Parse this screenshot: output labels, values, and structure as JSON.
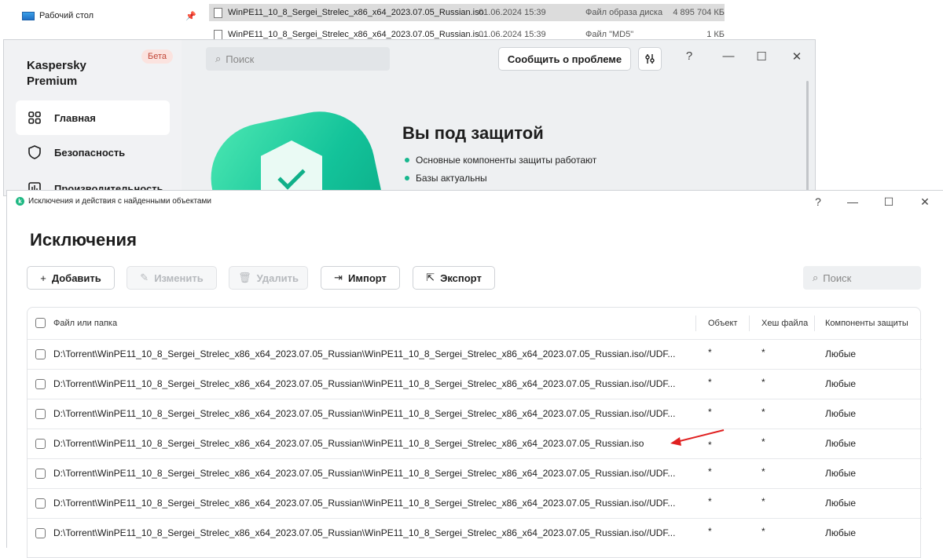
{
  "explorer": {
    "nav_desktop": "Рабочий стол",
    "files": [
      {
        "name": "WinPE11_10_8_Sergei_Strelec_x86_x64_2023.07.05_Russian.iso",
        "date": "01.06.2024 15:39",
        "type": "Файл образа диска",
        "size": "4 895 704 КБ"
      },
      {
        "name": "WinPE11_10_8_Sergei_Strelec_x86_x64_2023.07.05_Russian.is...",
        "date": "01.06.2024 15:39",
        "type": "Файл \"MD5\"",
        "size": "1 КБ"
      }
    ]
  },
  "kaspersky": {
    "brand": "Kaspersky Premium",
    "beta_badge": "Бета",
    "search_placeholder": "Поиск",
    "report_button": "Сообщить о проблеме",
    "window_controls": {
      "help": "?",
      "minimize": "—",
      "maximize": "☐",
      "close": "✕"
    },
    "sidebar": [
      {
        "label": "Главная",
        "icon": "grid-icon",
        "active": true
      },
      {
        "label": "Безопасность",
        "icon": "shield-icon",
        "active": false
      },
      {
        "label": "Производительность",
        "icon": "performance-icon",
        "active": false
      }
    ],
    "status": {
      "title": "Вы под защитой",
      "items": [
        "Основные компоненты защиты работают",
        "Базы актуальны"
      ]
    },
    "colors": {
      "accent": "#13c39a",
      "beta_bg": "#fbe3df",
      "beta_text": "#c2493a"
    }
  },
  "exceptions": {
    "window_title": "Исключения и действия с найденными объектами",
    "heading": "Исключения",
    "toolbar": {
      "add": "Добавить",
      "edit": "Изменить",
      "delete": "Удалить",
      "import": "Импорт",
      "export": "Экспорт",
      "search_placeholder": "Поиск"
    },
    "columns": [
      "Файл или папка",
      "Объект",
      "Хеш файла",
      "Компоненты защиты"
    ],
    "rows": [
      {
        "path": "D:\\Torrent\\WinPE11_10_8_Sergei_Strelec_x86_x64_2023.07.05_Russian\\WinPE11_10_8_Sergei_Strelec_x86_x64_2023.07.05_Russian.iso//UDF...",
        "object": "*",
        "hash": "*",
        "components": "Любые"
      },
      {
        "path": "D:\\Torrent\\WinPE11_10_8_Sergei_Strelec_x86_x64_2023.07.05_Russian\\WinPE11_10_8_Sergei_Strelec_x86_x64_2023.07.05_Russian.iso//UDF...",
        "object": "*",
        "hash": "*",
        "components": "Любые"
      },
      {
        "path": "D:\\Torrent\\WinPE11_10_8_Sergei_Strelec_x86_x64_2023.07.05_Russian\\WinPE11_10_8_Sergei_Strelec_x86_x64_2023.07.05_Russian.iso//UDF...",
        "object": "*",
        "hash": "*",
        "components": "Любые"
      },
      {
        "path": "D:\\Torrent\\WinPE11_10_8_Sergei_Strelec_x86_x64_2023.07.05_Russian\\WinPE11_10_8_Sergei_Strelec_x86_x64_2023.07.05_Russian.iso",
        "object": "*",
        "hash": "*",
        "components": "Любые"
      },
      {
        "path": "D:\\Torrent\\WinPE11_10_8_Sergei_Strelec_x86_x64_2023.07.05_Russian\\WinPE11_10_8_Sergei_Strelec_x86_x64_2023.07.05_Russian.iso//UDF...",
        "object": "*",
        "hash": "*",
        "components": "Любые"
      },
      {
        "path": "D:\\Torrent\\WinPE11_10_8_Sergei_Strelec_x86_x64_2023.07.05_Russian\\WinPE11_10_8_Sergei_Strelec_x86_x64_2023.07.05_Russian.iso//UDF...",
        "object": "*",
        "hash": "*",
        "components": "Любые"
      },
      {
        "path": "D:\\Torrent\\WinPE11_10_8_Sergei_Strelec_x86_x64_2023.07.05_Russian\\WinPE11_10_8_Sergei_Strelec_x86_x64_2023.07.05_Russian.iso//UDF...",
        "object": "*",
        "hash": "*",
        "components": "Любые"
      }
    ],
    "annotation_arrow_color": "#e02020"
  }
}
